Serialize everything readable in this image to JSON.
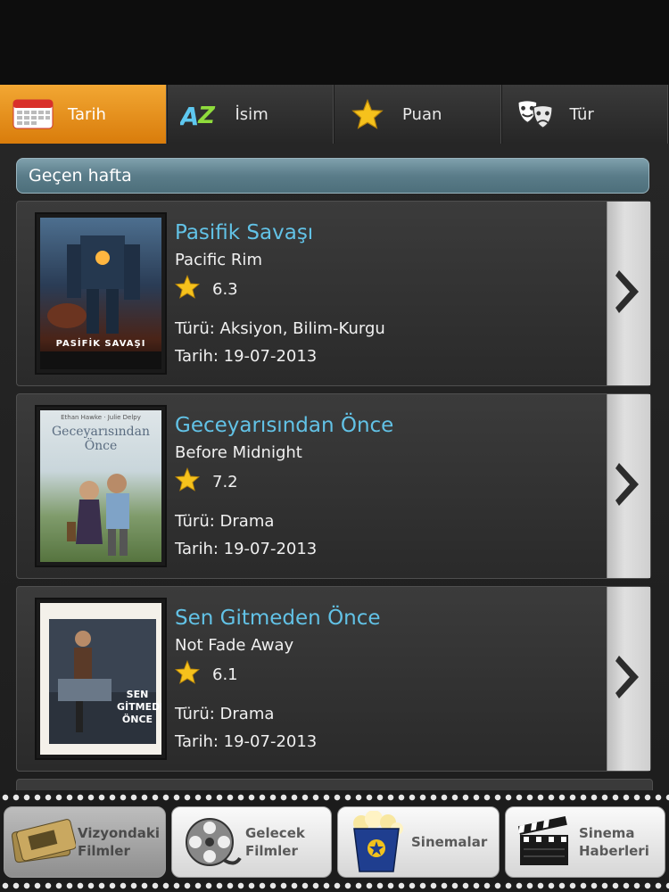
{
  "tabs": [
    {
      "label": "Tarih",
      "icon": "calendar-icon",
      "active": true
    },
    {
      "label": "İsim",
      "icon": "az-sort-icon",
      "active": false
    },
    {
      "label": "Puan",
      "icon": "star-icon",
      "active": false
    },
    {
      "label": "Tür",
      "icon": "theater-masks-icon",
      "active": false
    }
  ],
  "section_header": "Geçen hafta",
  "movies": [
    {
      "title": "Pasifik Savaşı",
      "original_title": "Pacific Rim",
      "rating": "6.3",
      "genre": "Türü: Aksiyon, Bilim-Kurgu",
      "date": "Tarih: 19-07-2013",
      "poster_text": "PASİFİK SAVAŞI"
    },
    {
      "title": "Geceyarısından Önce",
      "original_title": "Before Midnight",
      "rating": "7.2",
      "genre": "Türü: Drama",
      "date": "Tarih: 19-07-2013",
      "poster_text": "Geceyarısından Önce",
      "poster_subtext": "Ethan Hawke · Julie Delpy"
    },
    {
      "title": "Sen Gitmeden Önce",
      "original_title": "Not Fade Away",
      "rating": "6.1",
      "genre": "Türü: Drama",
      "date": "Tarih: 19-07-2013",
      "poster_text": "SEN GİTMEDEN ÖNCE"
    }
  ],
  "bottom_nav": [
    {
      "label": "Vizyondaki\nFilmler",
      "icon": "ticket-icon",
      "active": true
    },
    {
      "label": "Gelecek\nFilmler",
      "icon": "film-reel-icon",
      "active": false
    },
    {
      "label": "Sinemalar",
      "icon": "popcorn-icon",
      "active": false
    },
    {
      "label": "Sinema\nHaberleri",
      "icon": "clapperboard-icon",
      "active": false
    }
  ],
  "colors": {
    "active_tab": "#e8920f",
    "title": "#62c2e6",
    "section_header": "#5a7c89"
  }
}
